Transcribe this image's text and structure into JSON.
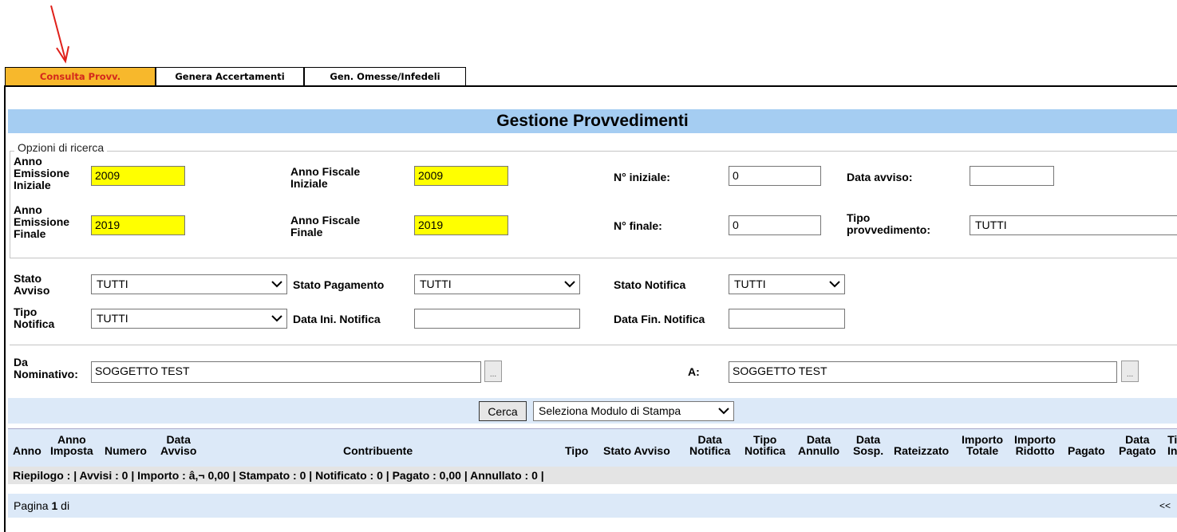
{
  "colors": {
    "active_tab_bg": "#f7b82c",
    "active_tab_text": "#d4281c",
    "title_bg": "#a5cdf2",
    "highlight_input": "#ffff00",
    "panel_bg": "#dce9f8"
  },
  "tabs": [
    {
      "label": "Consulta Provv.",
      "active": true
    },
    {
      "label": "Genera Accertamenti",
      "active": false
    },
    {
      "label": "Gen. Omesse/Infedeli",
      "active": false
    }
  ],
  "page_title": "Gestione Provvedimenti",
  "search_options": {
    "legend": "Opzioni di ricerca",
    "anno_emissione_iniziale": {
      "label_1": "Anno",
      "label_2": "Emissione",
      "label_3": "Iniziale",
      "value": "2009"
    },
    "anno_emissione_finale": {
      "label_1": "Anno",
      "label_2": "Emissione",
      "label_3": "Finale",
      "value": "2019"
    },
    "anno_fiscale_iniziale": {
      "label_1": "Anno Fiscale",
      "label_2": "Iniziale",
      "value": "2009"
    },
    "anno_fiscale_finale": {
      "label_1": "Anno Fiscale",
      "label_2": "Finale",
      "value": "2019"
    },
    "n_iniziale": {
      "label": "N° iniziale:",
      "value": "0"
    },
    "n_finale": {
      "label": "N° finale:",
      "value": "0"
    },
    "data_avviso": {
      "label": "Data avviso:",
      "value": ""
    },
    "tipo_provvedimento": {
      "label_1": "Tipo",
      "label_2": "provvedimento:",
      "value": "TUTTI"
    },
    "stato_avviso": {
      "label_1": "Stato",
      "label_2": "Avviso",
      "value": "TUTTI"
    },
    "stato_pagamento": {
      "label": "Stato Pagamento",
      "value": "TUTTI"
    },
    "stato_notifica": {
      "label": "Stato Notifica",
      "value": "TUTTI"
    },
    "tipo_notifica": {
      "label_1": "Tipo",
      "label_2": "Notifica",
      "value": "TUTTI"
    },
    "data_ini_notifica": {
      "label": "Data Ini. Notifica",
      "value": ""
    },
    "data_fin_notifica": {
      "label": "Data Fin. Notifica",
      "value": ""
    },
    "da_nominativo": {
      "label_1": "Da",
      "label_2": "Nominativo:",
      "value": "SOGGETTO TEST"
    },
    "a_nominativo": {
      "label": "A:",
      "value": "SOGGETTO TEST"
    },
    "browse_label": "..."
  },
  "actions": {
    "search_button": "Cerca",
    "print_module": "Seleziona Modulo di Stampa"
  },
  "table": {
    "columns": {
      "anno": "Anno",
      "anno_imposta_1": "Anno",
      "anno_imposta_2": "Imposta",
      "numero": "Numero",
      "data_avviso_1": "Data",
      "data_avviso_2": "Avviso",
      "contribuente": "Contribuente",
      "tipo": "Tipo",
      "stato_avviso": "Stato Avviso",
      "data_notifica_1": "Data",
      "data_notifica_2": "Notifica",
      "tipo_notifica_1": "Tipo",
      "tipo_notifica_2": "Notifica",
      "data_annullo_1": "Data",
      "data_annullo_2": "Annullo",
      "data_sosp_1": "Data",
      "data_sosp_2": "Sosp.",
      "rateizzato": "Rateizzato",
      "importo_totale_1": "Importo",
      "importo_totale_2": "Totale",
      "importo_ridotto_1": "Importo",
      "importo_ridotto_2": "Ridotto",
      "pagato": "Pagato",
      "data_pagato_1": "Data",
      "data_pagato_2": "Pagato",
      "ti_1": "Ti",
      "ti_2": "In"
    },
    "summary": "Riepilogo : | Avvisi : 0 | Importo : â‚¬ 0,00 | Stampato : 0 | Notificato : 0 | Pagato : 0,00 | Annullato : 0 |"
  },
  "pager": {
    "prefix": "Pagina",
    "current": "1",
    "suffix": "di",
    "prev": "<<"
  }
}
